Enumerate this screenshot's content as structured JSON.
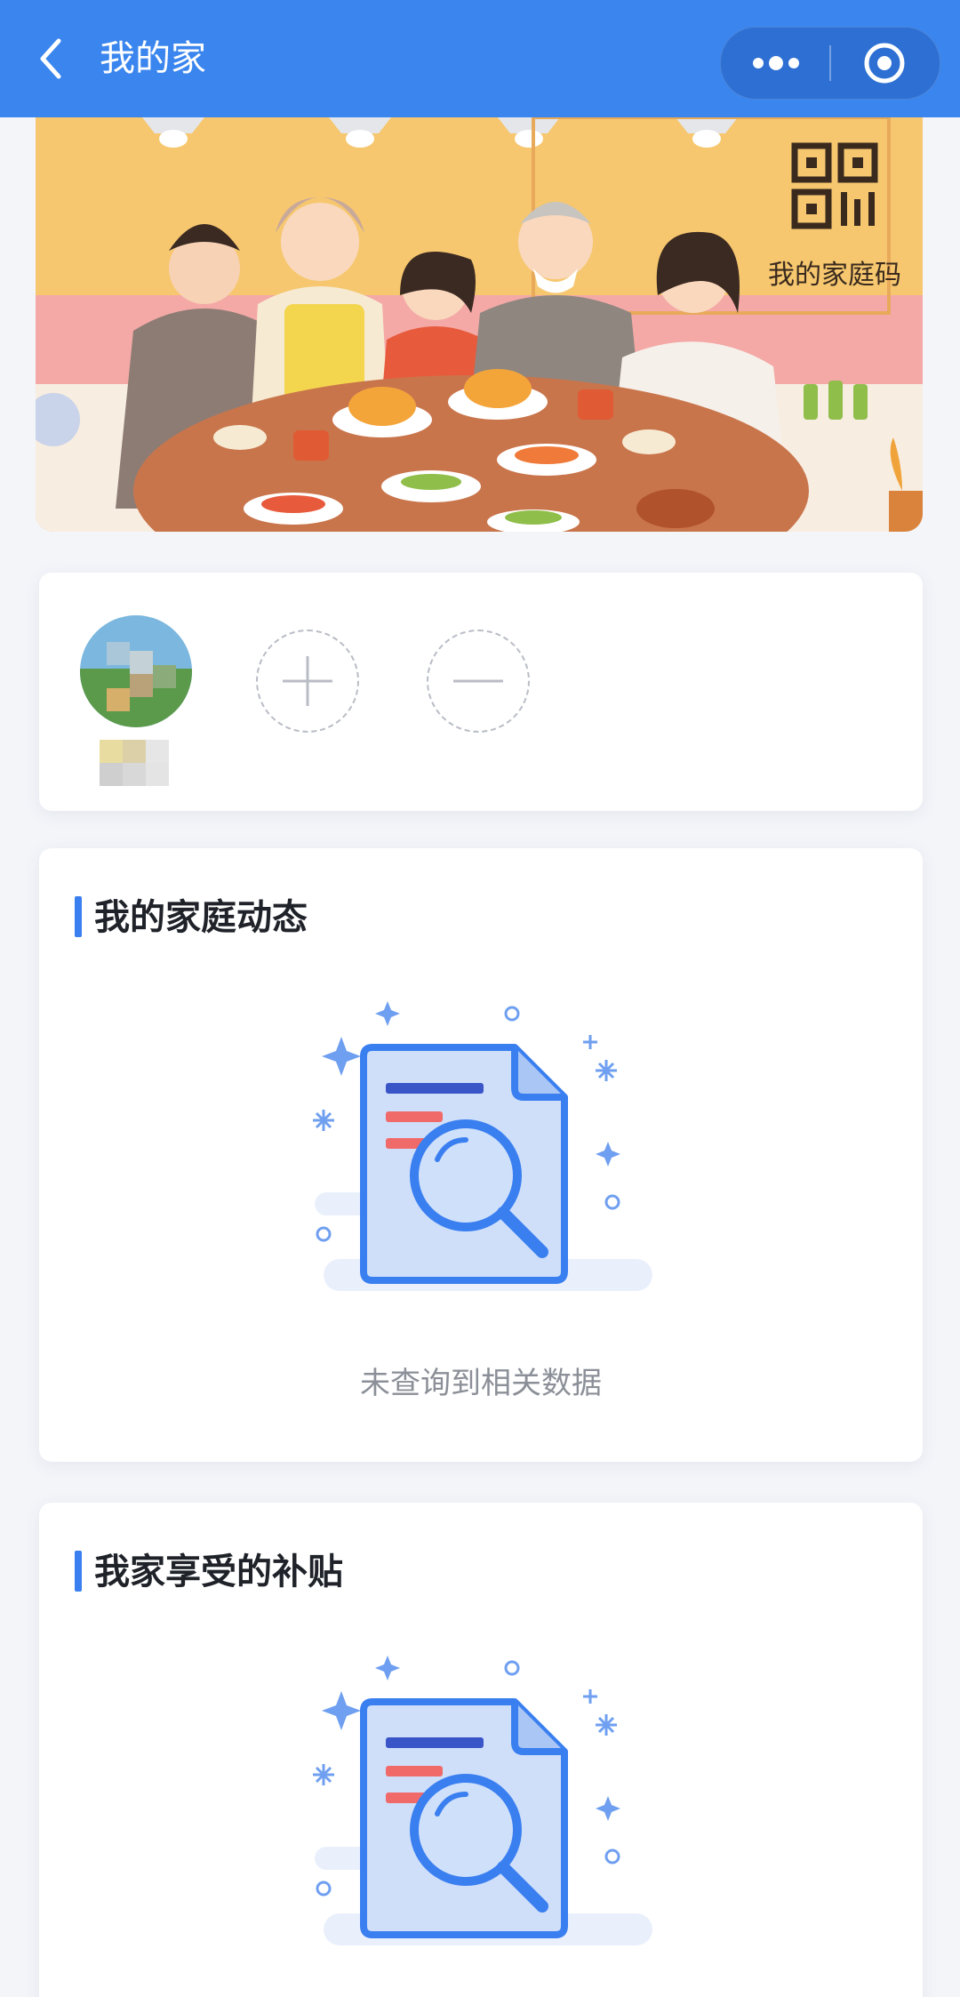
{
  "header": {
    "title": "我的家",
    "back_icon": "chevron-left-icon",
    "more_icon": "more-dots-icon",
    "close_icon": "target-circle-icon",
    "background": "#3a86ee"
  },
  "banner": {
    "qr_label": "我的家庭码",
    "qr_icon": "qr-code-icon",
    "illustration": "family-dinner-illustration"
  },
  "members": {
    "add_icon": "plus-icon",
    "remove_icon": "minus-icon"
  },
  "sections": [
    {
      "title": "我的家庭动态",
      "empty_text": "未查询到相关数据",
      "empty_icon": "document-search-icon"
    },
    {
      "title": "我家享受的补贴",
      "empty_icon": "document-search-icon"
    }
  ],
  "colors": {
    "accent": "#3a7ff0",
    "illustration_blue": "#3a7ff0",
    "illustration_red": "#f06a6a"
  }
}
